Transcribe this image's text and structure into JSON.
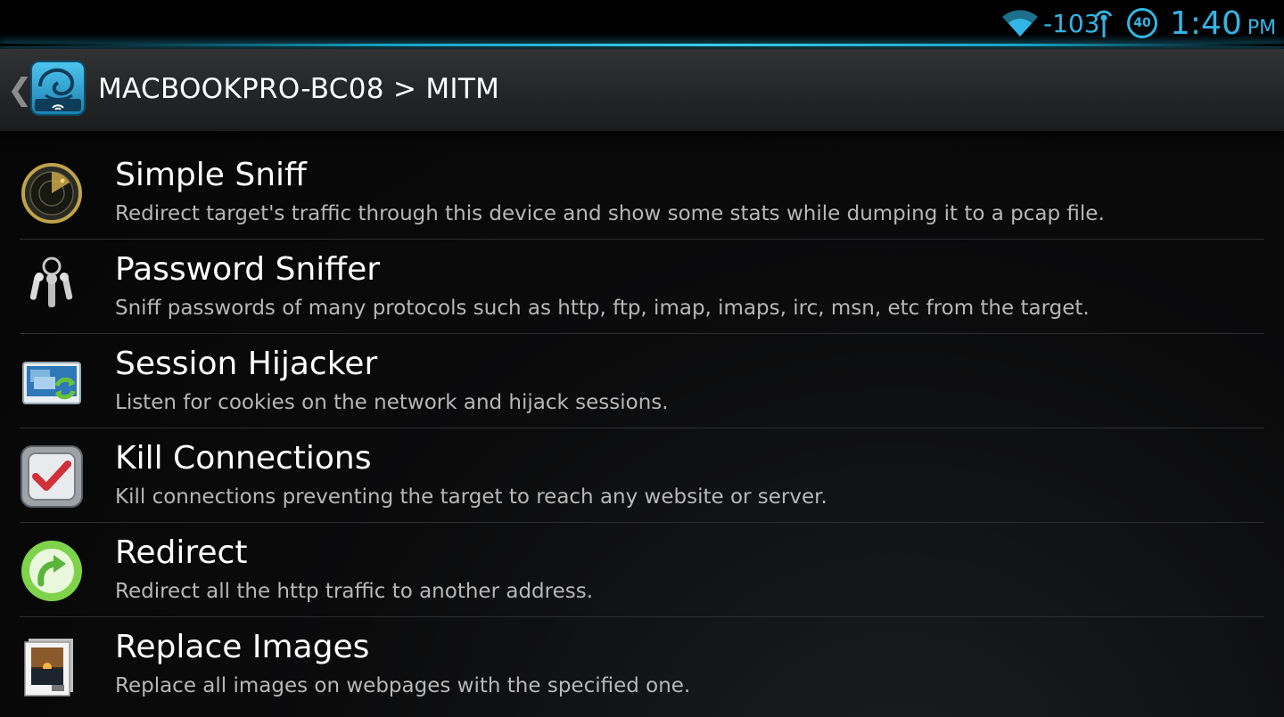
{
  "status_bar": {
    "signal_strength": "-103",
    "battery_level": "40",
    "time": "1:40",
    "ampm": "PM",
    "accent_color": "#33b5e5"
  },
  "action_bar": {
    "title": "MACBOOKPRO-BC08 > MITM",
    "up_icon": "chevron-left-icon",
    "app_icon": "app-logo-icon"
  },
  "items": [
    {
      "title": "Simple Sniff",
      "description": "Redirect target's traffic through this device and show some stats while dumping it to a pcap file.",
      "icon": "radar-icon"
    },
    {
      "title": "Password Sniffer",
      "description": "Sniff passwords of many protocols such as http, ftp, imap, imaps, irc, msn, etc from the target.",
      "icon": "keys-icon"
    },
    {
      "title": "Session Hijacker",
      "description": "Listen for cookies on the network and hijack sessions.",
      "icon": "session-swap-icon"
    },
    {
      "title": "Kill Connections",
      "description": "Kill connections preventing the target to reach any website or server.",
      "icon": "checkmark-box-icon"
    },
    {
      "title": "Redirect",
      "description": "Redirect all the http traffic to another address.",
      "icon": "redirect-arrow-icon"
    },
    {
      "title": "Replace Images",
      "description": "Replace all images on webpages with the specified one.",
      "icon": "image-file-icon"
    }
  ]
}
